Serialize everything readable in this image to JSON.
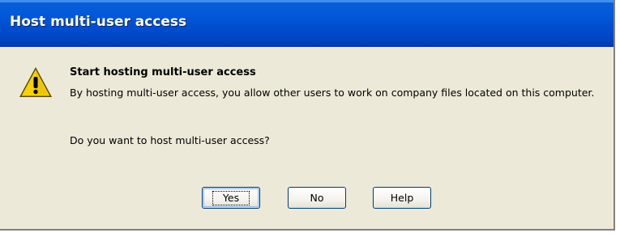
{
  "window": {
    "title": "Host multi-user access"
  },
  "message": {
    "icon": "warning-icon",
    "heading": "Start hosting multi-user access",
    "body": "By hosting multi-user access, you allow other users to work on company files located on this computer.",
    "question": "Do you want to host multi-user access?"
  },
  "buttons": {
    "yes": "Yes",
    "no": "No",
    "help": "Help"
  },
  "colors": {
    "titlebar": "#0054e3",
    "dialog_background": "#ece9d8",
    "warning_icon": "#f5d20a"
  }
}
